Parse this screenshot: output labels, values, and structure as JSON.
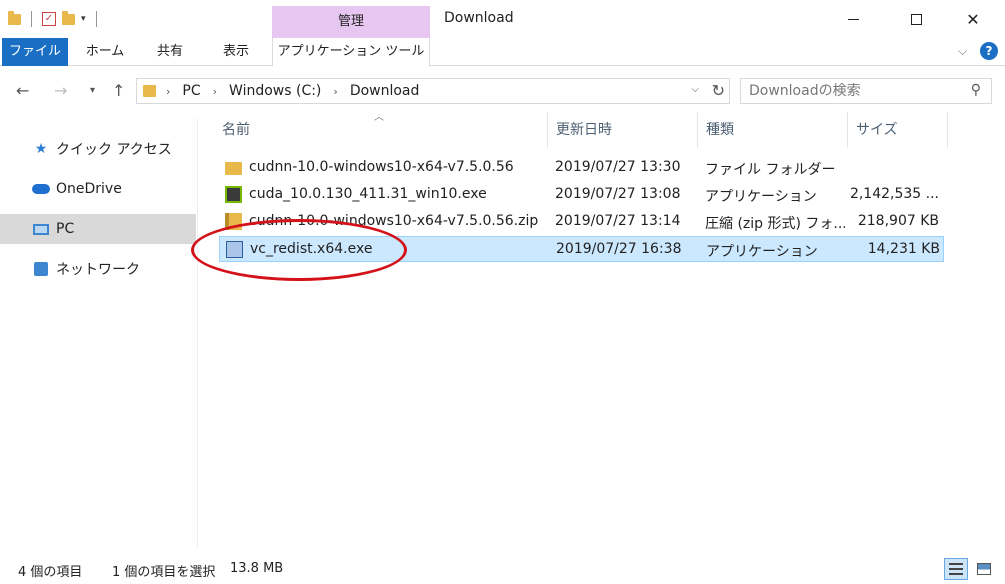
{
  "window": {
    "title": "Download",
    "context_tab_header": "管理",
    "min_label": "",
    "max_label": "",
    "close_label": "✕"
  },
  "ribbon": {
    "tabs": [
      "ファイル",
      "ホーム",
      "共有",
      "表示",
      "アプリケーション ツール"
    ]
  },
  "address": {
    "segments": [
      "PC",
      "Windows (C:)",
      "Download"
    ],
    "search_placeholder": "Downloadの検索"
  },
  "sidebar": {
    "items": [
      {
        "label": "クイック アクセス",
        "icon": "star-icon"
      },
      {
        "label": "OneDrive",
        "icon": "cloud-icon"
      },
      {
        "label": "PC",
        "icon": "computer-icon",
        "selected": true
      },
      {
        "label": "ネットワーク",
        "icon": "network-icon"
      }
    ]
  },
  "columns": {
    "name": "名前",
    "date": "更新日時",
    "type": "種類",
    "size": "サイズ"
  },
  "files": [
    {
      "name": "cudnn-10.0-windows10-x64-v7.5.0.56",
      "date": "2019/07/27 13:30",
      "type": "ファイル フォルダー",
      "size": "",
      "icon": "folder-icon"
    },
    {
      "name": "cuda_10.0.130_411.31_win10.exe",
      "date": "2019/07/27 13:08",
      "type": "アプリケーション",
      "size": "2,142,535 ...",
      "icon": "nvidia-app-icon"
    },
    {
      "name": "cudnn-10.0-windows10-x64-v7.5.0.56.zip",
      "date": "2019/07/27 13:14",
      "type": "圧縮 (zip 形式) フォ...",
      "size": "218,907 KB",
      "icon": "zip-icon"
    },
    {
      "name": "vc_redist.x64.exe",
      "date": "2019/07/27 16:38",
      "type": "アプリケーション",
      "size": "14,231 KB",
      "icon": "setup-icon",
      "selected": true
    }
  ],
  "status": {
    "item_count": "4 個の項目",
    "selection": "1 個の項目を選択",
    "selection_size": "13.8 MB"
  },
  "colors": {
    "file_tab": "#1a6fc4",
    "context_header": "#e7c6f1",
    "selection_fill": "#cce8ff",
    "annotation": "#d4121a"
  }
}
